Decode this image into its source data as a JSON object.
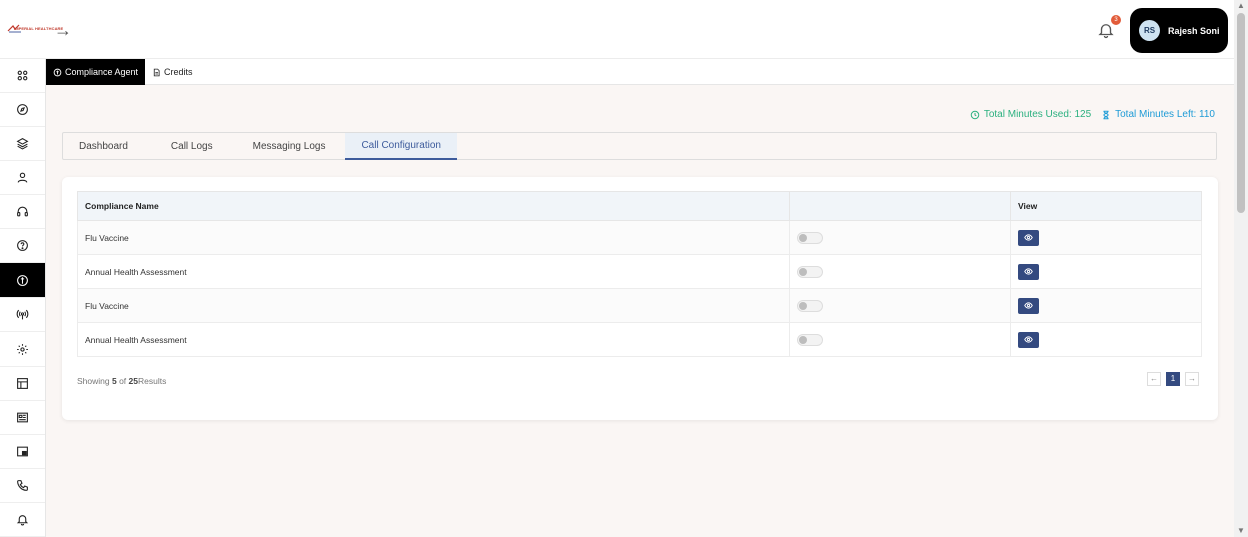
{
  "header": {
    "logo_text": "IMPERIAL HEALTHCARE",
    "notification_count": "3",
    "user_initials": "RS",
    "user_name": "Rajesh Soni"
  },
  "sidebar": {
    "items": [
      "grid-icon",
      "compass-icon",
      "layers-icon",
      "user-icon",
      "headset-icon",
      "help-icon",
      "compliance-icon",
      "broadcast-icon",
      "settings-icon",
      "layout-icon",
      "newspaper-icon",
      "picture-in-picture-icon",
      "phone-icon",
      "bell-icon"
    ],
    "active_index": 6
  },
  "top_tabs": [
    {
      "label": "Compliance Agent",
      "icon": "compliance-icon",
      "active": true
    },
    {
      "label": "Credits",
      "icon": "document-icon",
      "active": false
    }
  ],
  "stats": {
    "used": "Total Minutes Used: 125",
    "left": "Total Minutes Left: 110",
    "used_color": "#2bb07f",
    "left_color": "#1e9bd6"
  },
  "tabs": [
    {
      "label": "Dashboard",
      "active": false
    },
    {
      "label": "Call Logs",
      "active": false
    },
    {
      "label": "Messaging Logs",
      "active": false
    },
    {
      "label": "Call Configuration",
      "active": true
    }
  ],
  "table": {
    "headers": [
      "Compliance Name",
      "",
      "View"
    ],
    "rows": [
      {
        "name": "Flu Vaccine",
        "enabled": false
      },
      {
        "name": "Annual Health Assessment",
        "enabled": false
      },
      {
        "name": "Flu Vaccine",
        "enabled": false
      },
      {
        "name": "Annual Health Assessment",
        "enabled": false
      }
    ]
  },
  "footer": {
    "showing_prefix": "Showing ",
    "shown": "5",
    "of": " of ",
    "total": "25",
    "suffix": "Results",
    "prev": "←",
    "page": "1",
    "next": "→"
  },
  "colors": {
    "accent": "#344a80",
    "active_tab": "#3d5b9c"
  }
}
